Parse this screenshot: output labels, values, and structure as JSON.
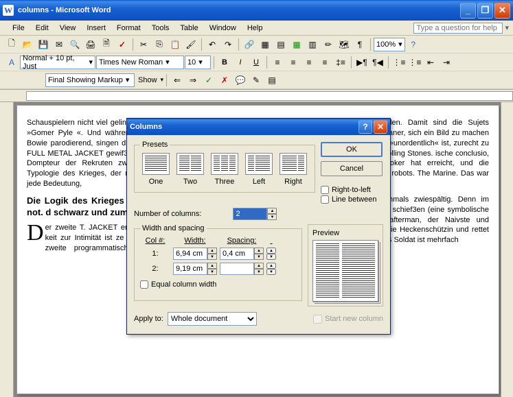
{
  "title": "columns - Microsoft Word",
  "menus": [
    "File",
    "Edit",
    "View",
    "Insert",
    "Format",
    "Tools",
    "Table",
    "Window",
    "Help"
  ],
  "qhelp_placeholder": "Type a question for help",
  "toolbar": {
    "zoom": "100%",
    "style": "Normal + 10 pt, Just",
    "font": "Times New Roman",
    "size": "10",
    "markup": "Final Showing Markup",
    "show": "Show"
  },
  "doc": {
    "p1": "Schauspielern nicht viel gelingt, präsentiert ihn Hartman Joker als »Gomer Pyle «. Und während die Todesengel singen — David Bowie parodierend, singen die GIs das Parris Island. Insofern ist FULL METAL JACKET gewif3 eine Satire, eine Revue des Terrors Dompteur der Rekruten zwingt die Soldaten ins Korsett der Typologie des Krieges, der nur Tod Kubrick entdecken. Er frif3t jede Bedeutung,",
    "heading": "Die Logik des Krieges on and I am alive. And I am not. d schwarz und zum",
    "p2": "Der zweite T. JACKET erzäh. Drills: Die zivilen Existenzen si keit zur Intimität ist ze das Weibliche zurück Tod. Auch im zweite programmatisch: Er Prostituierten, die si wird Rafterman der Fotoapparat gestohlen. Damit sind die Sujets umrissen: die Unfähigkeit der Amerikaner, sich ein Bild zu machen und sich in einer Welt, die vor allem »unordentlich« ist, zurecht zu finden, in einer Welt, die auch den Rolling Stones. ische conclusio, kein s Krieges. Denn darin d. Joker hat erreicht, und die symbolische estellt, das Weibliche et robots. The Marine. Das war Hartmans es verwirklicht.",
    "p3": "Freilich ist auch diese Lesart nochmals zwiespältig. Denn im Kampf kann Joker nicht auf die Frau schief3en (eine symbolische Ladehemmung) - ausgerechnet Rafterman, der Naivste und Schwächste der Truppe, erschiefßt die Heckenschützin und rettet Joker das Leben. Jokers »Geburt« als Soldat ist mehrfach"
  },
  "dialog": {
    "title": "Columns",
    "presets_label": "Presets",
    "presets": {
      "one": "One",
      "two": "Two",
      "three": "Three",
      "left": "Left",
      "right": "Right"
    },
    "ok": "OK",
    "cancel": "Cancel",
    "rtl": "Right-to-left",
    "lb": "Line between",
    "numcols_label": "Number of columns:",
    "numcols_value": "2",
    "ws_label": "Width and spacing",
    "colnum_hdr": "Col #:",
    "width_hdr": "Width:",
    "spacing_hdr": "Spacing:",
    "col1": "1:",
    "col2": "2:",
    "w1": "6,94 cm",
    "w2": "9,19 cm",
    "s1": "0,4 cm",
    "s2": "",
    "equal": "Equal column width",
    "preview_label": "Preview",
    "applyto_label": "Apply to:",
    "applyto_value": "Whole document",
    "start_new": "Start new column"
  }
}
